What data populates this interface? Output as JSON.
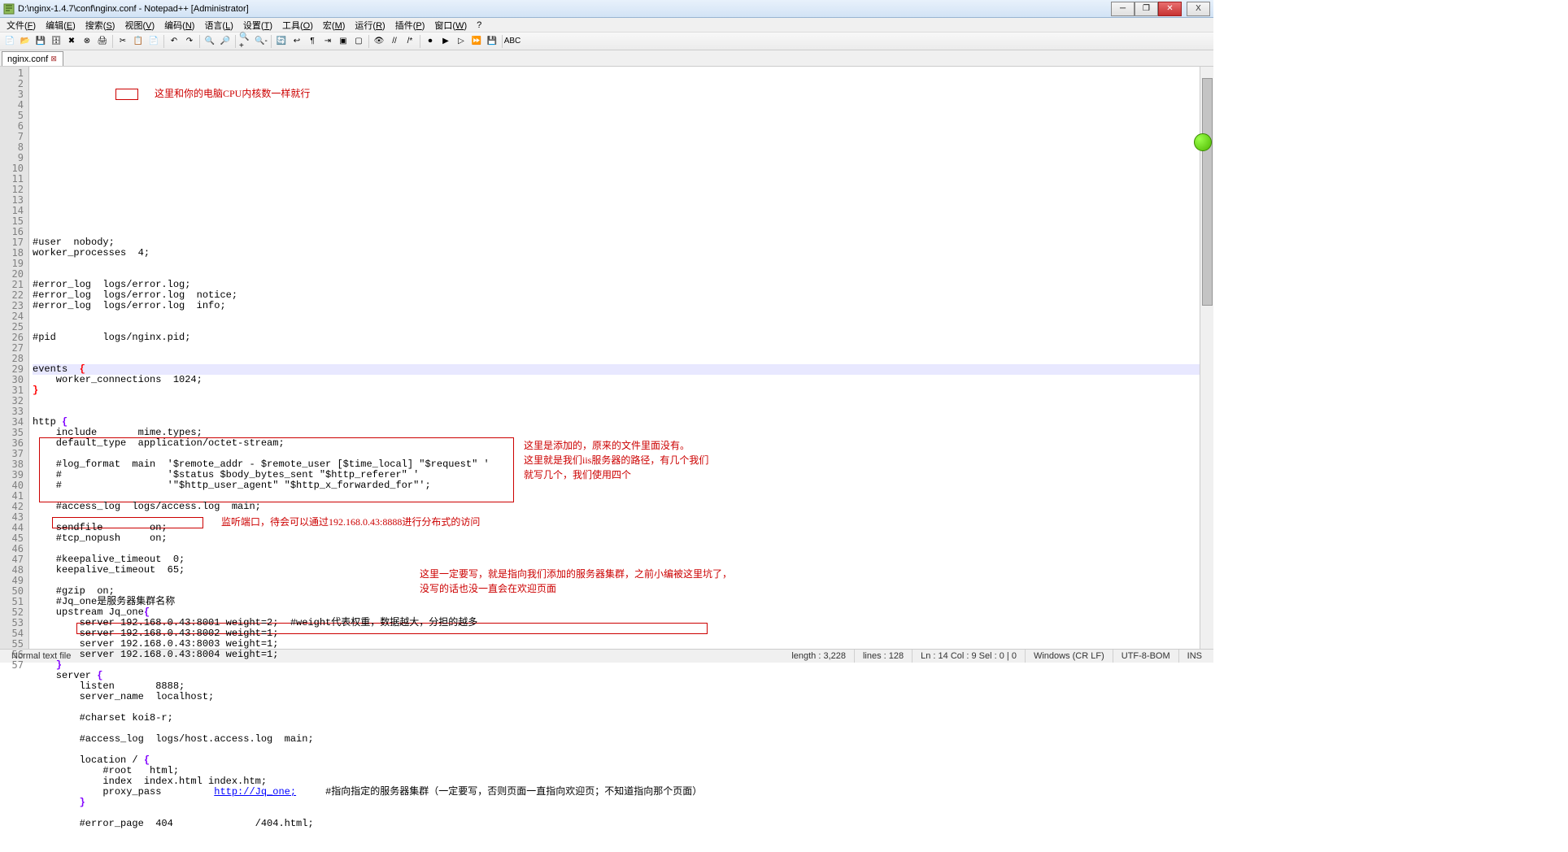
{
  "title": "D:\\nginx-1.4.7\\conf\\nginx.conf - Notepad++ [Administrator]",
  "menu": [
    "文件(F)",
    "编辑(E)",
    "搜索(S)",
    "视图(V)",
    "编码(N)",
    "语言(L)",
    "设置(T)",
    "工具(O)",
    "宏(M)",
    "运行(R)",
    "插件(P)",
    "窗口(W)",
    "?"
  ],
  "tab": {
    "name": "nginx.conf"
  },
  "annotations": {
    "a1": "这里和你的电脑CPU内核数一样就行",
    "a2_l1": "这里是添加的，原来的文件里面没有。",
    "a2_l2": "这里就是我们iis服务器的路径，有几个我们",
    "a2_l3": "就写几个，我们使用四个",
    "a3": "监听端口，待会可以通过192.168.0.43:8888进行分布式的访问",
    "a4_l1": "这里一定要写，就是指向我们添加的服务器集群，之前小编被这里坑了，",
    "a4_l2": "没写的话也没一直会在欢迎页面"
  },
  "code": {
    "lines": [
      "",
      "#user  nobody;",
      "worker_processes  4;",
      "",
      "",
      "#error_log  logs/error.log;",
      "#error_log  logs/error.log  notice;",
      "#error_log  logs/error.log  info;",
      "",
      "",
      "#pid        logs/nginx.pid;",
      "",
      "",
      "events  {",
      "    worker_connections  1024;",
      "}",
      "",
      "",
      "http {",
      "    include       mime.types;",
      "    default_type  application/octet-stream;",
      "",
      "    #log_format  main  '$remote_addr - $remote_user [$time_local] \"$request\" '",
      "    #                  '$status $body_bytes_sent \"$http_referer\" '",
      "    #                  '\"$http_user_agent\" \"$http_x_forwarded_for\"';",
      "",
      "    #access_log  logs/access.log  main;",
      "",
      "    sendfile        on;",
      "    #tcp_nopush     on;",
      "",
      "    #keepalive_timeout  0;",
      "    keepalive_timeout  65;",
      "",
      "    #gzip  on;",
      "    #Jq_one是服务器集群名称",
      "    upstream Jq_one{",
      "        server 192.168.0.43:8001 weight=2;  #weight代表权重，数据越大，分担的越多",
      "        server 192.168.0.43:8002 weight=1;",
      "        server 192.168.0.43:8003 weight=1;",
      "        server 192.168.0.43:8004 weight=1;",
      "    }",
      "    server {",
      "        listen       8888;",
      "        server_name  localhost;",
      "",
      "        #charset koi8-r;",
      "",
      "        #access_log  logs/host.access.log  main;",
      "",
      "        location / {",
      "            #root   html;",
      "            index  index.html index.htm;",
      "            proxy_pass         http://Jq_one;     #指向指定的服务器集群（一定要写，否则页面一直指向欢迎页；不知道指向那个页面）",
      "        }",
      "",
      "        #error_page  404              /404.html;"
    ]
  },
  "status": {
    "left": "Normal text file",
    "length": "length : 3,228",
    "lines": "lines : 128",
    "pos": "Ln : 14    Col : 9    Sel : 0 | 0",
    "eol": "Windows (CR LF)",
    "enc": "UTF-8-BOM",
    "mode": "INS"
  },
  "toolbar_icons": [
    "new",
    "open",
    "save",
    "save-all",
    "close",
    "close-all",
    "print",
    "|",
    "cut",
    "copy",
    "paste",
    "|",
    "undo",
    "redo",
    "|",
    "find",
    "replace",
    "|",
    "zoom-in",
    "zoom-out",
    "|",
    "sync",
    "wrap",
    "all-chars",
    "indent",
    "fold",
    "unfold",
    "|",
    "hidden",
    "comment",
    "uncomment",
    "|",
    "rec",
    "play",
    "play1",
    "play-multi",
    "save-macro",
    "|",
    "spellcheck"
  ]
}
